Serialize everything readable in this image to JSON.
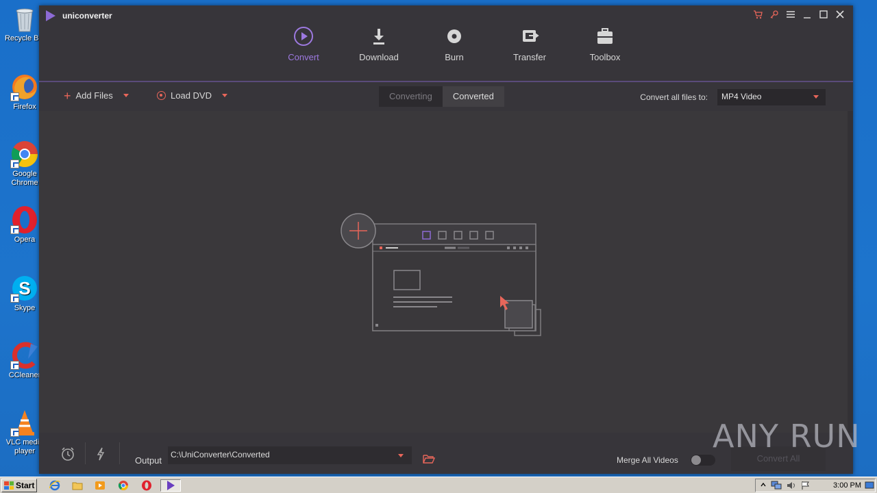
{
  "desktop": {
    "icons": [
      {
        "label": "Recycle Bin",
        "icon": "recycle-bin-icon"
      },
      {
        "label": "Firefox",
        "icon": "firefox-icon"
      },
      {
        "label": "Google Chrome",
        "icon": "chrome-icon"
      },
      {
        "label": "Opera",
        "icon": "opera-icon"
      },
      {
        "label": "Skype",
        "icon": "skype-icon"
      },
      {
        "label": "CCleaner",
        "icon": "ccleaner-icon"
      },
      {
        "label": "VLC media player",
        "icon": "vlc-icon"
      }
    ]
  },
  "app": {
    "title": "uniconverter",
    "accent": "#8d6bd6",
    "highlight": "#e8665a",
    "nav": [
      {
        "label": "Convert",
        "icon": "convert-icon",
        "active": true
      },
      {
        "label": "Download",
        "icon": "download-icon"
      },
      {
        "label": "Burn",
        "icon": "burn-icon"
      },
      {
        "label": "Transfer",
        "icon": "transfer-icon"
      },
      {
        "label": "Toolbox",
        "icon": "toolbox-icon"
      }
    ],
    "toolbar": {
      "add_files": "Add Files",
      "load_dvd": "Load DVD",
      "tab_converting": "Converting",
      "tab_converted": "Converted",
      "convert_all_to_label": "Convert all files to:",
      "format_value": "MP4 Video"
    },
    "footer": {
      "output_label": "Output",
      "output_path": "C:\\UniConverter\\Converted",
      "merge_label": "Merge All Videos",
      "merge_on": false,
      "convert_all": "Convert All"
    }
  },
  "watermark": "ANY RUN",
  "taskbar": {
    "start": "Start",
    "clock": "3:00 PM"
  }
}
